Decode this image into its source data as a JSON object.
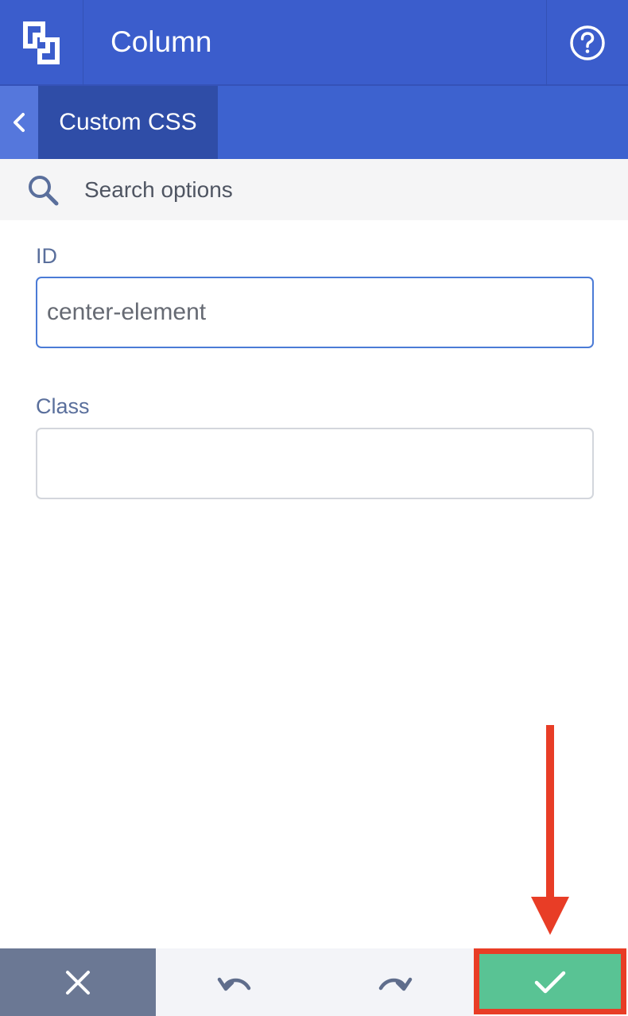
{
  "header": {
    "logo_icon": "builder-logo-icon",
    "title": "Column",
    "help_icon": "help-circle-icon"
  },
  "subbar": {
    "back_icon": "chevron-left-icon",
    "breadcrumb": "Custom CSS"
  },
  "search": {
    "icon": "search-icon",
    "placeholder": "Search options"
  },
  "fields": {
    "id_label": "ID",
    "id_value": "center-element",
    "class_label": "Class",
    "class_value": ""
  },
  "footer": {
    "close_icon": "close-icon",
    "undo_icon": "undo-icon",
    "redo_icon": "redo-icon",
    "save_icon": "check-icon"
  },
  "annotation": {
    "arrow_icon": "arrow-down-icon",
    "color": "#e83d26"
  },
  "colors": {
    "primary": "#3b5dcc",
    "save": "#59c394",
    "close": "#6b7894"
  }
}
